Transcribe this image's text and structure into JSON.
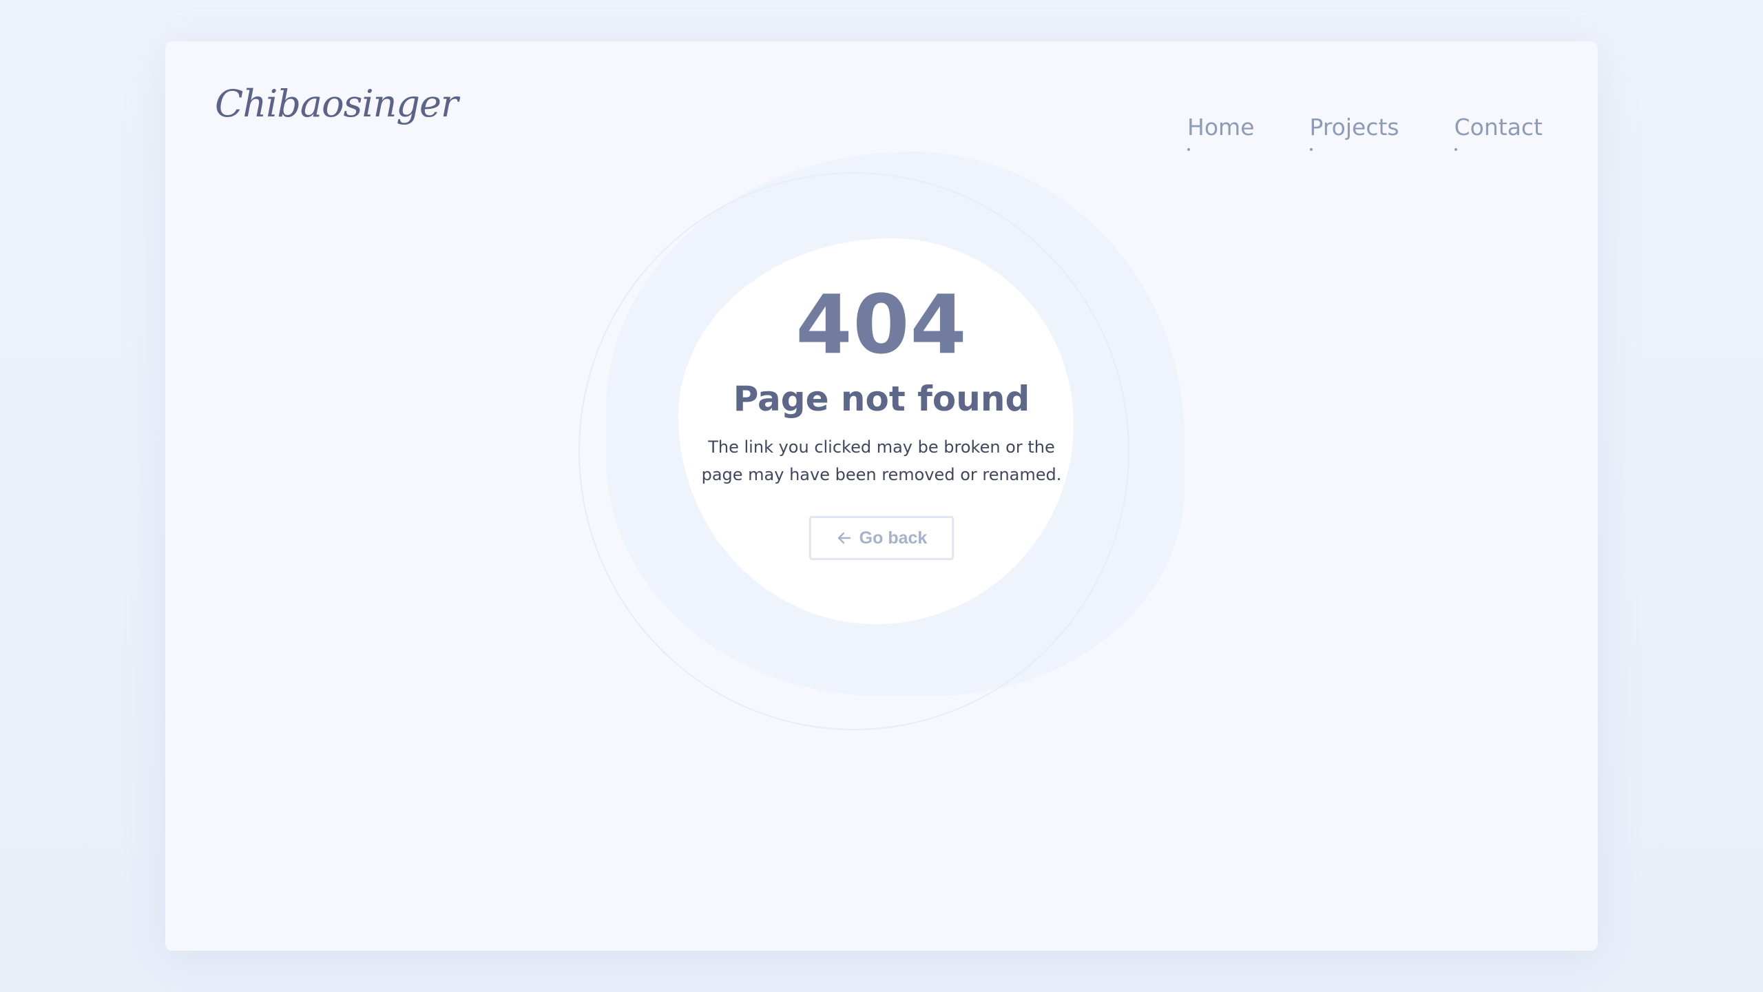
{
  "header": {
    "logo_text": "Chibaosinger",
    "nav": [
      {
        "label": "Home"
      },
      {
        "label": "Projects"
      },
      {
        "label": "Contact"
      }
    ]
  },
  "error": {
    "code": "404",
    "title": "Page not found",
    "description": "The link you clicked may be broken or the page may have been removed or renamed.",
    "button_label": "Go back",
    "button_icon": "arrow-left-icon"
  },
  "colors": {
    "page_background": "#eef2fa",
    "card_background": "#f6f8fd",
    "blob_background": "#eef3fc",
    "circle_background": "#ffffff",
    "heading": "#717c9f",
    "nav_text": "#8d9ab8",
    "button_text": "#a7b1cc"
  }
}
